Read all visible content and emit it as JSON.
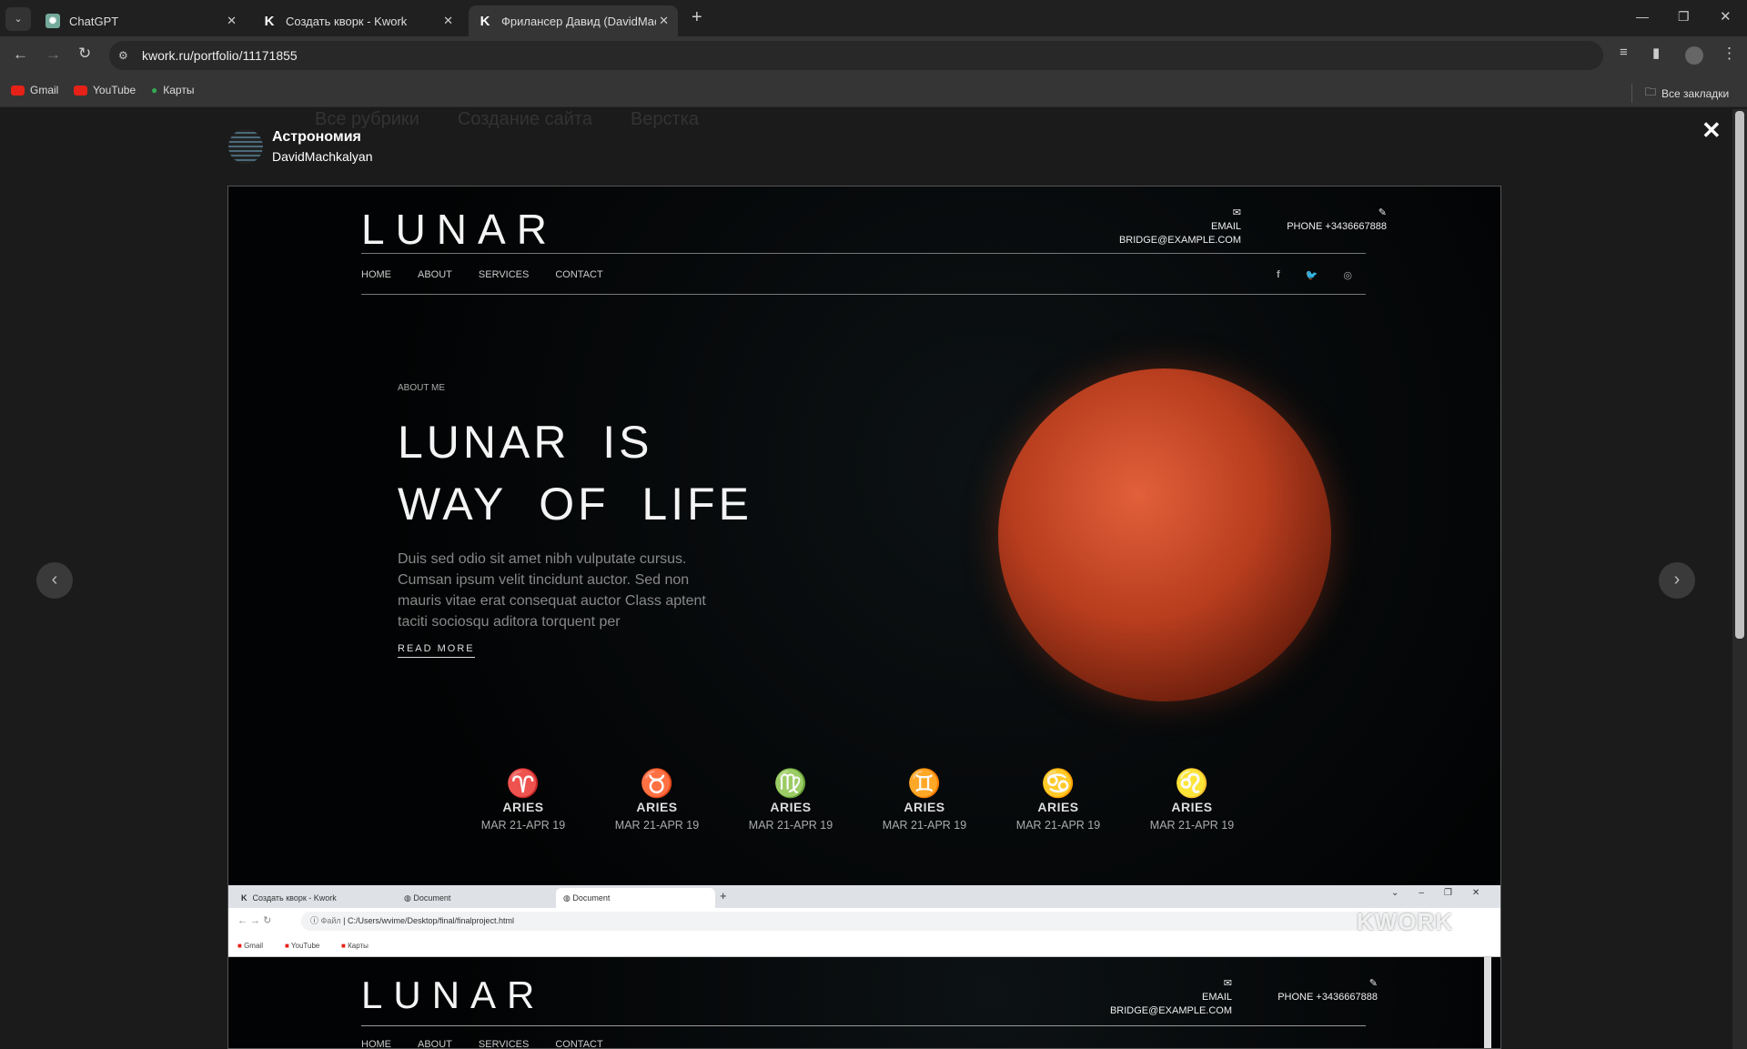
{
  "browser": {
    "tabs": [
      {
        "label": "ChatGPT"
      },
      {
        "label": "Создать кворк - Kwork"
      },
      {
        "label": "Фрилансер Давид (DavidMach"
      }
    ],
    "url": "kwork.ru/portfolio/11171855",
    "bookmarks": [
      "Gmail",
      "YouTube",
      "Карты"
    ],
    "all_bookmarks": "Все закладки"
  },
  "background_tabs": [
    "Все рубрики",
    "Создание сайта",
    "Верстка"
  ],
  "modal": {
    "title": "Астрономия",
    "author": "DavidMachkalyan"
  },
  "site": {
    "logo": "LUNAR",
    "email_label": "EMAIL",
    "email": "BRIDGE@EXAMPLE.COM",
    "phone": "PHONE +3436667888",
    "nav": [
      "HOME",
      "ABOUT",
      "SERVICES",
      "CONTACT"
    ],
    "social": [
      "f",
      "t",
      "ig"
    ],
    "eyebrow": "ABOUT ME",
    "heading1": "LUNAR  IS",
    "heading2": "WAY  OF  LIFE",
    "paragraph": "Duis sed odio sit amet nibh vulputate cursus. Cumsan ipsum velit tincidunt auctor. Sed non mauris vitae erat consequat auctor Class aptent taciti sociosqu aditora torquent per",
    "read_more": "READ MORE",
    "zodiac": [
      {
        "glyph": "♈",
        "name": "ARIES",
        "dates": "MAR 21-APR 19"
      },
      {
        "glyph": "♉",
        "name": "ARIES",
        "dates": "MAR 21-APR 19"
      },
      {
        "glyph": "♍",
        "name": "ARIES",
        "dates": "MAR 21-APR 19"
      },
      {
        "glyph": "♊",
        "name": "ARIES",
        "dates": "MAR 21-APR 19"
      },
      {
        "glyph": "♋",
        "name": "ARIES",
        "dates": "MAR 21-APR 19"
      },
      {
        "glyph": "♌",
        "name": "ARIES",
        "dates": "MAR 21-APR 19"
      }
    ]
  },
  "inner_browser": {
    "tabs": [
      "Создать кворк - Kwork",
      "Document",
      "Document"
    ],
    "file_label": "Файл",
    "path": "C:/Users/wvime/Desktop/final/finalproject.html",
    "bookmarks": [
      "Gmail",
      "YouTube",
      "Карты"
    ],
    "watermark": "KWORK"
  }
}
